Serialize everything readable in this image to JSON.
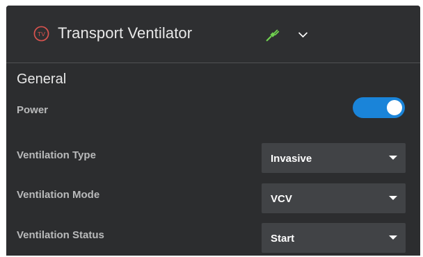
{
  "header": {
    "device_icon_letters": "TV",
    "title": "Transport Ventilator",
    "status_icon": "plug-icon",
    "expand_icon": "chevron-down-icon"
  },
  "section": {
    "title": "General"
  },
  "fields": {
    "power": {
      "label": "Power",
      "on": true
    },
    "ventilation_type": {
      "label": "Ventilation Type",
      "value": "Invasive"
    },
    "ventilation_mode": {
      "label": "Ventilation Mode",
      "value": "VCV"
    },
    "ventilation_status": {
      "label": "Ventilation Status",
      "value": "Start"
    }
  },
  "colors": {
    "panel": "#2e2f31",
    "accent": "#1a84d9",
    "device_icon": "#d9534f",
    "plug": "#6fcf4f"
  }
}
